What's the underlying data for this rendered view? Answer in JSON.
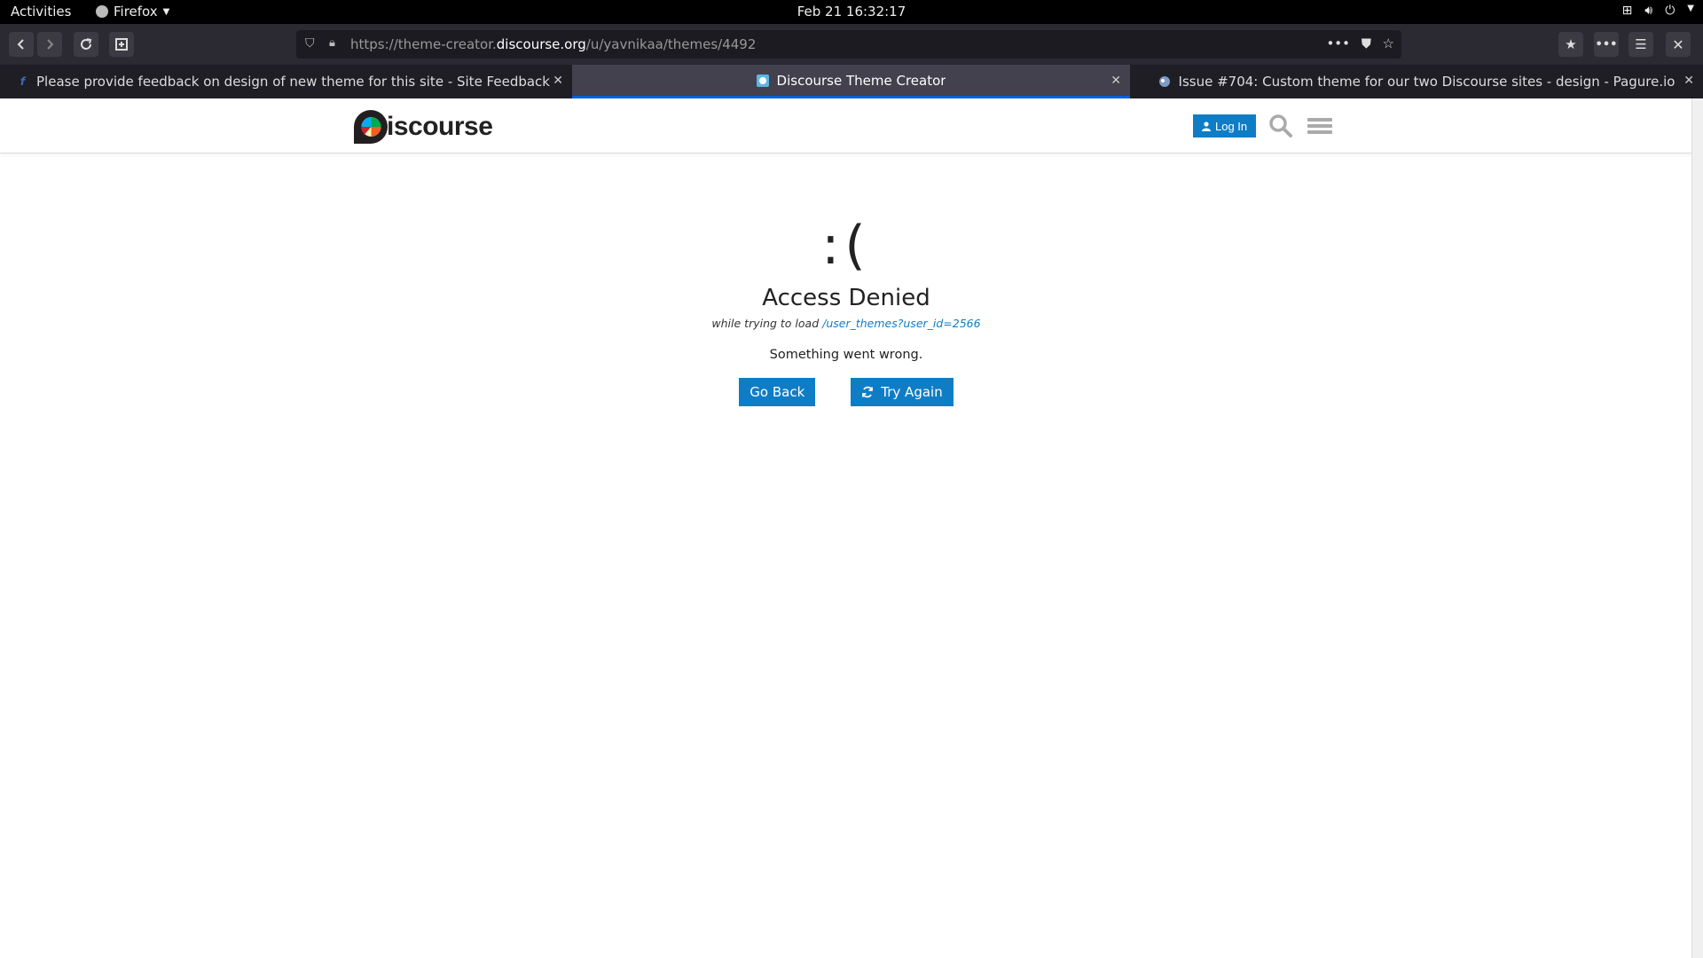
{
  "system": {
    "activities": "Activities",
    "app_menu": "Firefox",
    "clock": "Feb 21  16:32:17"
  },
  "browser": {
    "url_prefix": "https://theme-creator.",
    "url_domain": "discourse.org",
    "url_path": "/u/yavnikaa/themes/4492",
    "tabs": [
      {
        "title": "Please provide feedback on design of new theme for this site - Site Feedback - Ask Fedo",
        "favicon": "fedora-icon"
      },
      {
        "title": "Discourse Theme Creator",
        "favicon": "discourse-icon",
        "active": true
      },
      {
        "title": "Issue #704: Custom theme for our two Discourse sites - design - Pagure.io",
        "favicon": "pagure-icon"
      }
    ]
  },
  "site": {
    "logo_text": "iscourse",
    "login_label": "Log In",
    "brand_color": "#0f7dc6"
  },
  "error": {
    "face": ":(",
    "title": "Access Denied",
    "while_prefix": "while trying to load",
    "path": "/user_themes?user_id=2566",
    "message": "Something went wrong.",
    "go_back": "Go Back",
    "try_again": "Try Again"
  }
}
